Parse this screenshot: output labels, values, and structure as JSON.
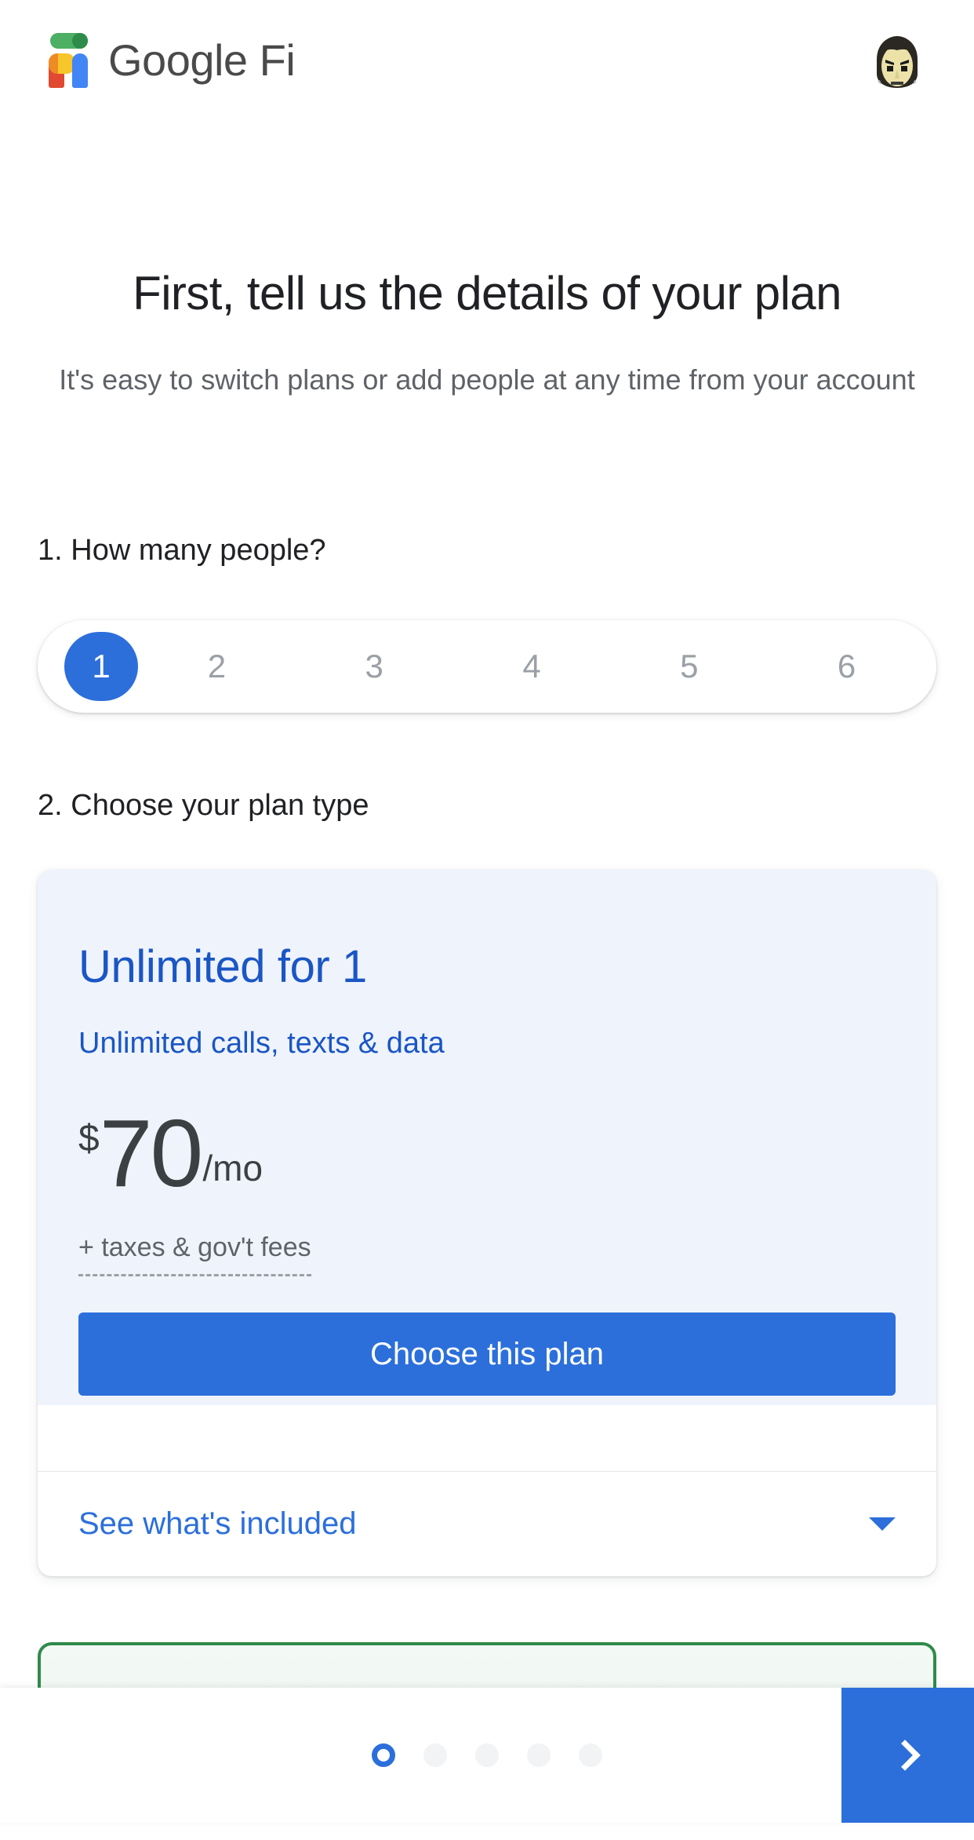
{
  "header": {
    "brand_google": "Google",
    "brand_fi": "Fi",
    "logo_icon": "google-fi-logo",
    "avatar_alt": "user-avatar"
  },
  "main": {
    "title": "First, tell us the details of your plan",
    "subtitle": "It's easy to switch plans or add people at any time from your account",
    "step1_label": "1. How many people?",
    "people_options": [
      "1",
      "2",
      "3",
      "4",
      "5",
      "6"
    ],
    "people_selected": "1",
    "step2_label": "2. Choose your plan type"
  },
  "plan_card": {
    "title": "Unlimited for 1",
    "description": "Unlimited calls, texts & data",
    "currency": "$",
    "price": "70",
    "period": "/mo",
    "tax_note": "+ taxes & gov't fees",
    "choose_label": "Choose this plan",
    "included_label": "See what's included",
    "caret_icon": "chevron-down-icon"
  },
  "bottom": {
    "dots_total": 5,
    "dot_current": 1,
    "next_icon": "chevron-right-icon"
  },
  "colors": {
    "accent_blue": "#2c6fdb",
    "plan_title_blue": "#1a56c4",
    "card_tint": "#eff3fc",
    "green_border": "#2E8B4A",
    "text_primary": "#202124",
    "text_secondary": "#5f6368",
    "muted": "#9aa0a6"
  }
}
